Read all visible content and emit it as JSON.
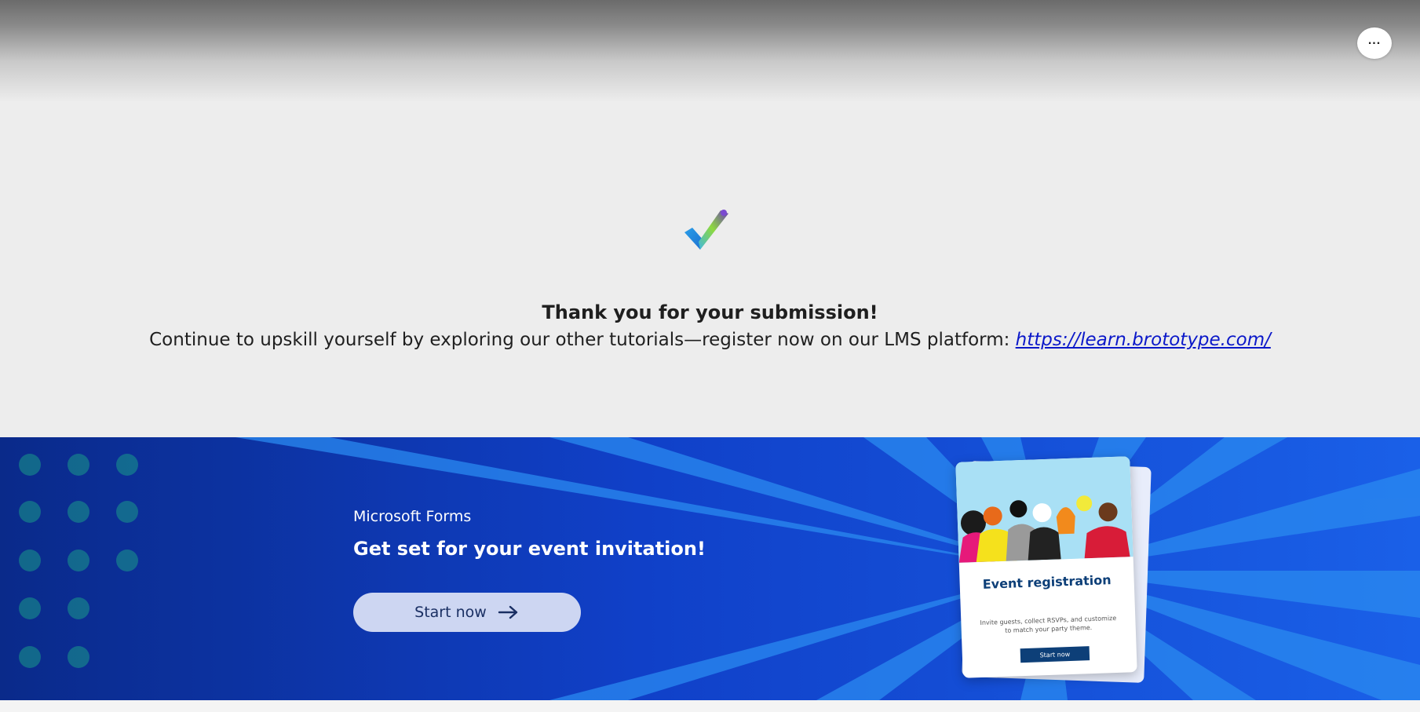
{
  "header": {
    "more_label": "..."
  },
  "confirmation": {
    "icon": "checkmark-icon",
    "title": "Thank you for your submission!",
    "message": "Continue to upskill yourself by exploring our other tutorials—register now on our LMS platform: ",
    "link_text": "https://learn.brototype.com/"
  },
  "promo": {
    "brand": "Microsoft Forms",
    "headline": "Get set for your event invitation!",
    "button_label": "Start now",
    "button_icon": "arrow-right-icon",
    "card": {
      "title": "Event registration",
      "text": "Invite guests, collect RSVPs, and customize to match your party theme.",
      "button_label": "Start now"
    }
  },
  "colors": {
    "banner_blue": "#1256d6",
    "link": "#0b18c9",
    "card_title": "#0d3f78"
  }
}
